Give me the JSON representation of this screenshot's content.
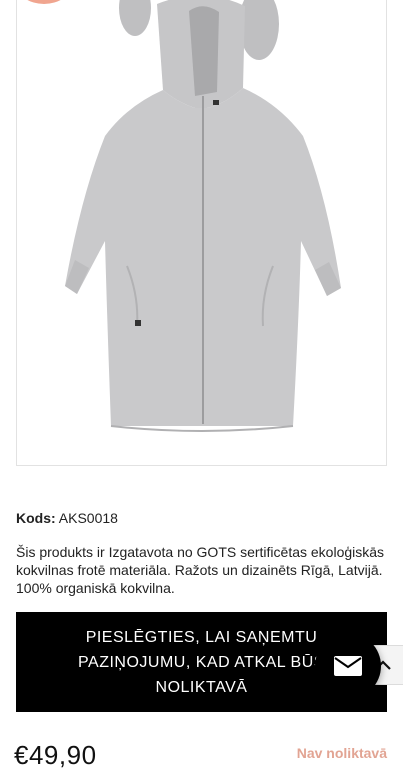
{
  "product": {
    "code_label": "Kods:",
    "code_value": "AKS0018",
    "description": "Šis produkts ir Izgatavota no GOTS sertificētas ekoloģiskās kokvilnas frotē materiāla. Ražots un dizainēts Rīgā, Latvijā. 100% organiskā kokvilna.",
    "price": "€49,90",
    "stock_status": "Nav noliktavā",
    "image_icon": "hooded-robe-image"
  },
  "notify": {
    "label": "PIESLĒGTIES, LAI SAŅEMTU PAZIŅOJUMU, KAD ATKAL BŪS NOLIKTAVĀ"
  },
  "widgets": {
    "mail_icon": "envelope-icon",
    "scroll_icon": "chevron-up-icon"
  },
  "colors": {
    "button_bg": "#000000",
    "stock_color": "#e2a493",
    "badge_color": "#f0a58f",
    "robe_color": "#c9c9cb"
  }
}
